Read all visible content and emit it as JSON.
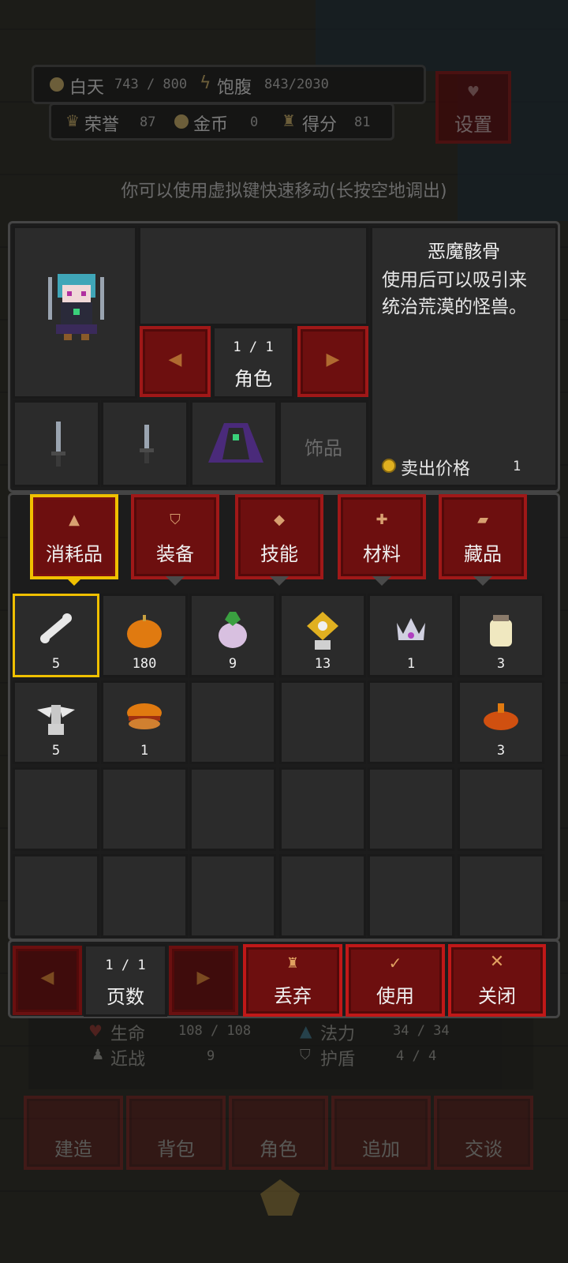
{
  "hud": {
    "day_label": "白天",
    "day_value": "743 / 800",
    "satiety_label": "饱腹",
    "satiety_value": "843/2030",
    "honor_label": "荣誉",
    "honor_value": "87",
    "gold_label": "金币",
    "gold_value": "0",
    "score_label": "得分",
    "score_value": "81",
    "settings_label": "设置"
  },
  "hint": "你可以使用虚拟键快速移动(长按空地调出)",
  "character": {
    "page": "1 / 1",
    "page_label": "角色",
    "accessory_label": "饰品"
  },
  "item_info": {
    "name": "恶魔骸骨",
    "description_line1": "使用后可以吸引来",
    "description_line2": "统治荒漠的怪兽。",
    "sell_label": "卖出价格",
    "sell_value": "1"
  },
  "tabs": [
    {
      "label": "消耗品",
      "icon": "potion-icon",
      "selected": true
    },
    {
      "label": "装备",
      "icon": "shield-icon",
      "selected": false
    },
    {
      "label": "技能",
      "icon": "diamond-icon",
      "selected": false
    },
    {
      "label": "材料",
      "icon": "material-icon",
      "selected": false
    },
    {
      "label": "藏品",
      "icon": "scroll-icon",
      "selected": false
    }
  ],
  "inventory": [
    {
      "icon": "bone-icon",
      "count": "5"
    },
    {
      "icon": "pumpkin-icon",
      "count": "180"
    },
    {
      "icon": "turnip-icon",
      "count": "9"
    },
    {
      "icon": "totem-icon",
      "count": "13"
    },
    {
      "icon": "crown-icon",
      "count": "1"
    },
    {
      "icon": "jar-icon",
      "count": "3"
    },
    {
      "icon": "winged-totem-icon",
      "count": "5"
    },
    {
      "icon": "burger-icon",
      "count": "1"
    },
    {
      "icon": "cake-icon",
      "count": "3"
    }
  ],
  "bottom_bar": {
    "page": "1 / 1",
    "page_label": "页数",
    "discard_label": "丢弃",
    "use_label": "使用",
    "close_label": "关闭"
  },
  "stats": {
    "hp_label": "生命",
    "hp_value": "108 / 108",
    "mp_label": "法力",
    "mp_value": "34 / 34",
    "melee_label": "近战",
    "melee_value": "9",
    "armor_label": "护盾",
    "armor_value": "4 / 4"
  },
  "nav": {
    "build": "建造",
    "bag": "背包",
    "role": "角色",
    "add": "追加",
    "talk": "交谈"
  },
  "colors": {
    "accent_red": "#6d0f0f",
    "selected_gold": "#f0c000",
    "panel": "#1c1c1c"
  }
}
